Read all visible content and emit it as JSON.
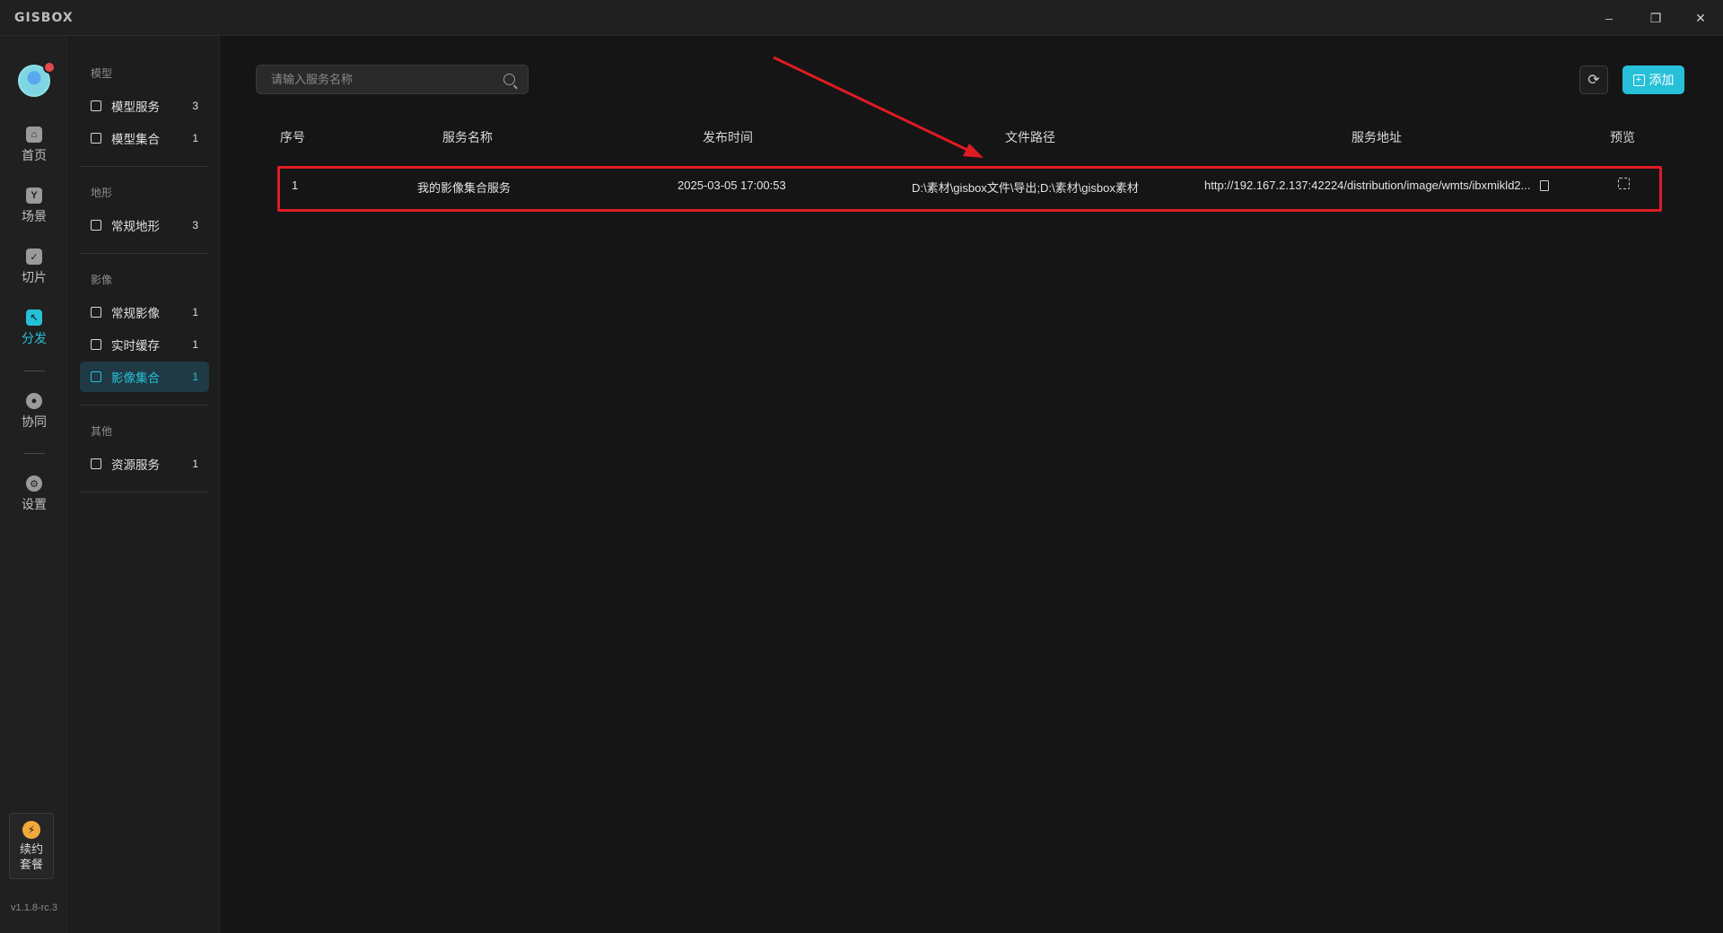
{
  "app": {
    "logo": "GISBOX"
  },
  "window_controls": {
    "minimize": "–",
    "restore": "❐",
    "close": "✕"
  },
  "rail": {
    "items": [
      {
        "label": "首页",
        "icon": "home-icon"
      },
      {
        "label": "场景",
        "icon": "scene-icon"
      },
      {
        "label": "切片",
        "icon": "tile-icon"
      },
      {
        "label": "分发",
        "icon": "distribute-icon"
      },
      {
        "label": "协同",
        "icon": "lock-icon"
      },
      {
        "label": "设置",
        "icon": "settings-icon"
      }
    ],
    "plan": {
      "line1": "续约",
      "line2": "套餐",
      "icon": "lightning-icon"
    },
    "version": "v1.1.8-rc.3"
  },
  "subnav": {
    "groups": [
      {
        "title": "模型",
        "items": [
          {
            "label": "模型服务",
            "count": "3"
          },
          {
            "label": "模型集合",
            "count": "1"
          }
        ]
      },
      {
        "title": "地形",
        "items": [
          {
            "label": "常规地形",
            "count": "3"
          }
        ]
      },
      {
        "title": "影像",
        "items": [
          {
            "label": "常规影像",
            "count": "1"
          },
          {
            "label": "实时缓存",
            "count": "1"
          },
          {
            "label": "影像集合",
            "count": "1"
          }
        ]
      },
      {
        "title": "其他",
        "items": [
          {
            "label": "资源服务",
            "count": "1"
          }
        ]
      }
    ],
    "active": "影像集合"
  },
  "search": {
    "placeholder": "请输入服务名称",
    "value": ""
  },
  "toolbar": {
    "add_label": "添加"
  },
  "table": {
    "headers": [
      "序号",
      "服务名称",
      "发布时间",
      "文件路径",
      "服务地址",
      "预览"
    ],
    "rows": [
      {
        "index": "1",
        "name": "我的影像集合服务",
        "time": "2025-03-05 17:00:53",
        "path": "D:\\素材\\gisbox文件\\导出;D:\\素材\\gisbox素材",
        "url": "http://192.167.2.137:42224/distribution/image/wmts/ibxmikld2..."
      }
    ]
  },
  "colors": {
    "accent": "#27c0d9",
    "highlight": "#e01b24",
    "background": "#151515"
  }
}
